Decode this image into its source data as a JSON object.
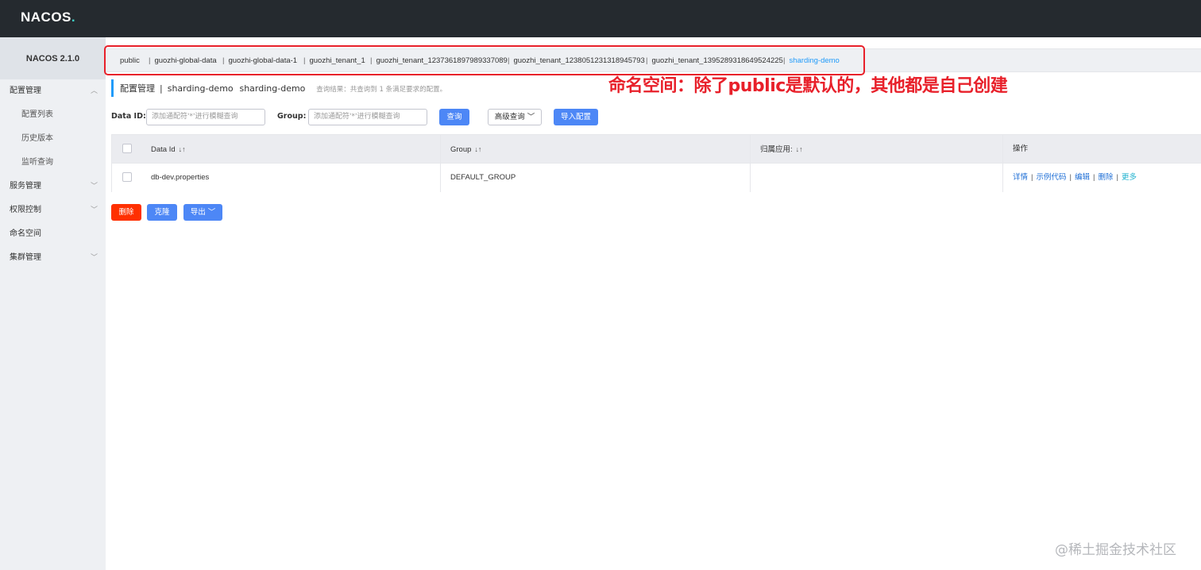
{
  "topbar": {
    "logo_main": "NACOS",
    "logo_dot": "."
  },
  "sidebar": {
    "title": "NACOS 2.1.0",
    "items": [
      {
        "label": "配置管理",
        "expanded": true
      },
      {
        "label": "配置列表",
        "sub": true
      },
      {
        "label": "历史版本",
        "sub": true
      },
      {
        "label": "监听查询",
        "sub": true
      },
      {
        "label": "服务管理",
        "expanded": false
      },
      {
        "label": "权限控制",
        "expanded": false
      },
      {
        "label": "命名空间"
      },
      {
        "label": "集群管理",
        "expanded": false
      }
    ]
  },
  "namespaces": {
    "items": [
      "public",
      "guozhi-global-data",
      "guozhi-global-data-1",
      "guozhi_tenant_1",
      "guozhi_tenant_1237361897989337089",
      "guozhi_tenant_1238051231318945793",
      "guozhi_tenant_1395289318649524225",
      "sharding-demo"
    ],
    "separator": "|",
    "active": "sharding-demo"
  },
  "annotation": {
    "text": "命名空间：除了public是默认的，其他都是自己创建"
  },
  "breadcrumb": {
    "title": "配置管理",
    "separator": "|",
    "namespace_name": "sharding-demo",
    "namespace_id": "sharding-demo",
    "hint": "查询结果：共查询到 1 条满足要求的配置。"
  },
  "filters": {
    "data_id_label": "Data ID:",
    "data_id_placeholder": "添加通配符'*'进行模糊查询",
    "group_label": "Group:",
    "group_placeholder": "添加通配符'*'进行模糊查询",
    "query_button": "查询",
    "advanced_button": "高级查询",
    "import_button": "导入配置"
  },
  "table": {
    "columns": [
      "Data Id",
      "Group",
      "归属应用:",
      "操作"
    ],
    "rows": [
      {
        "data_id": "db-dev.properties",
        "group": "DEFAULT_GROUP",
        "app": "",
        "actions": [
          "详情",
          "示例代码",
          "编辑",
          "删除",
          "更多"
        ]
      }
    ]
  },
  "bulk_actions": {
    "delete": "删除",
    "clone": "克隆",
    "export": "导出"
  },
  "watermark": "@稀土掘金技术社区",
  "colors": {
    "accent": "#4d87f6",
    "danger": "#ff3000",
    "annotation": "#e8202a",
    "active_namespace": "#209bfa",
    "topbar": "#252a2f"
  }
}
